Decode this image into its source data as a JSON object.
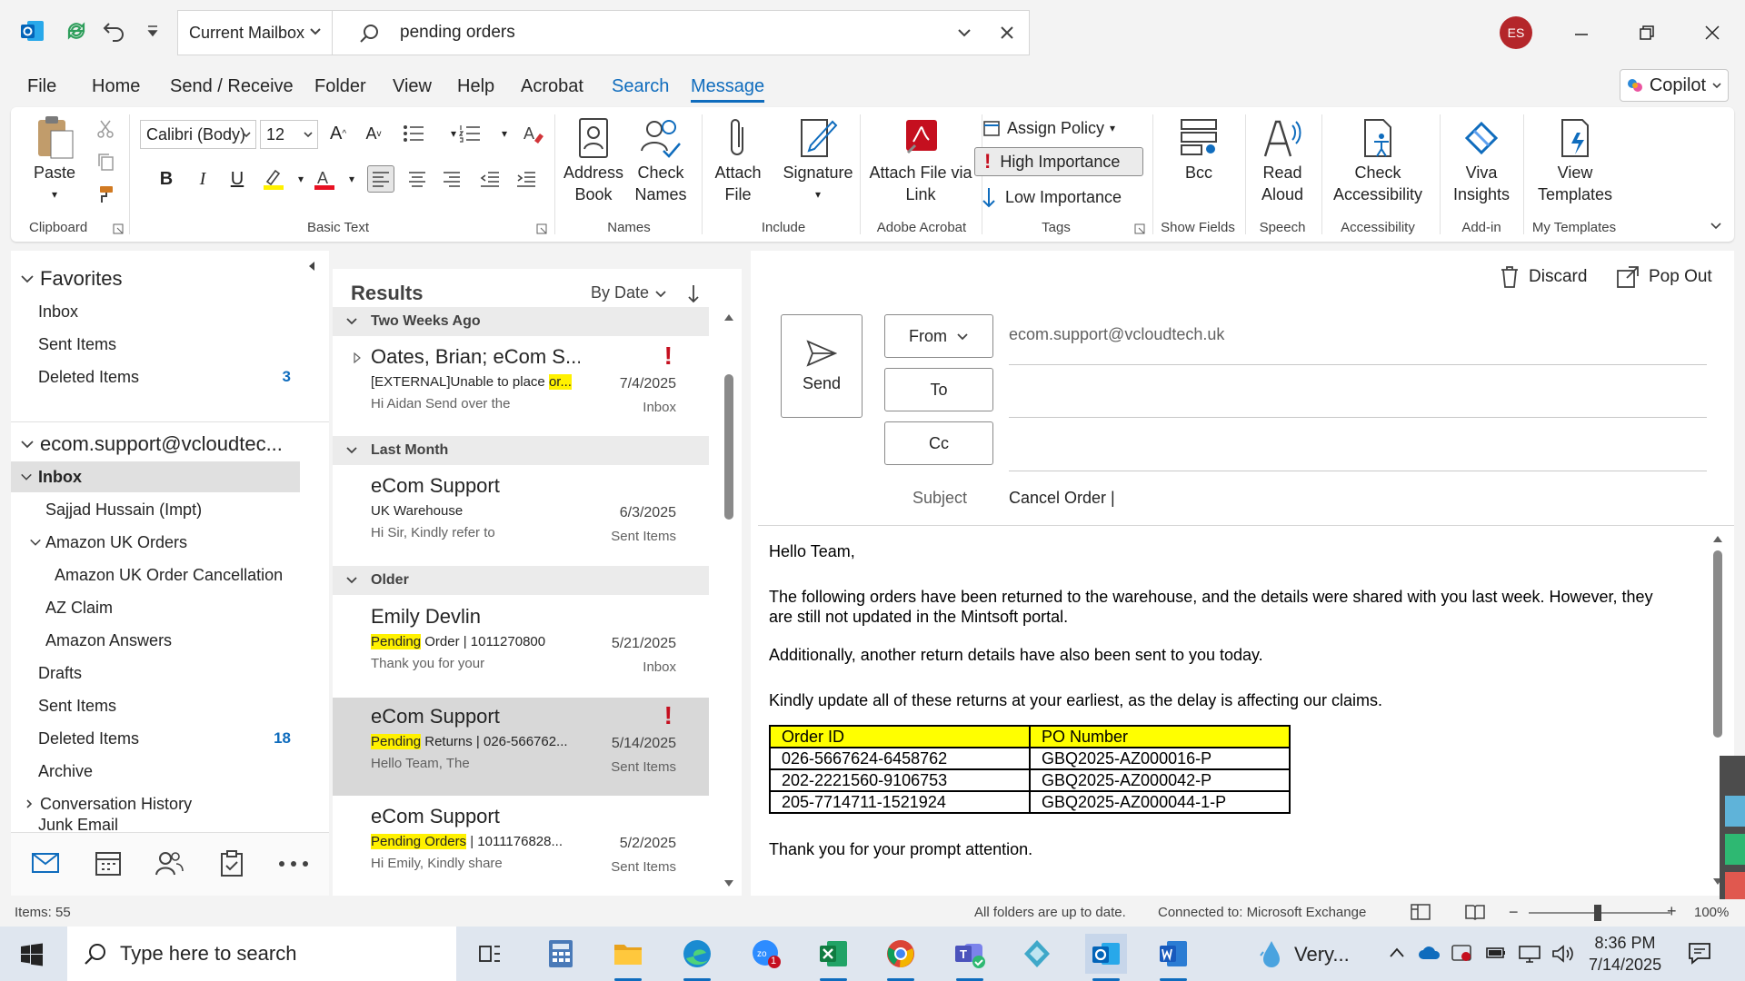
{
  "titlebar": {
    "scope_label": "Current Mailbox",
    "search_value": "pending orders",
    "avatar_initials": "ES"
  },
  "menu": {
    "tabs": [
      "File",
      "Home",
      "Send / Receive",
      "Folder",
      "View",
      "Help",
      "Acrobat",
      "Search",
      "Message"
    ],
    "active_tab": "Message",
    "copilot_label": "Copilot"
  },
  "ribbon": {
    "paste_label": "Paste",
    "font_name": "Calibri (Body)",
    "font_size": "12",
    "address_book_label": "Address Book",
    "check_names_label": "Check Names",
    "attach_file_label": "Attach File",
    "signature_label": "Signature",
    "attach_via_link_label": "Attach File via Link",
    "assign_policy_label": "Assign Policy",
    "high_importance_label": "High Importance",
    "low_importance_label": "Low Importance",
    "bcc_label": "Bcc",
    "read_aloud_label": "Read Aloud",
    "check_accessibility_label": "Check Accessibility",
    "viva_insights_label": "Viva Insights",
    "view_templates_label": "View Templates",
    "groups": {
      "clipboard": "Clipboard",
      "basic_text": "Basic Text",
      "names": "Names",
      "include": "Include",
      "adobe_acrobat": "Adobe Acrobat",
      "tags": "Tags",
      "show_fields": "Show Fields",
      "speech": "Speech",
      "accessibility": "Accessibility",
      "add_in": "Add-in",
      "my_templates": "My Templates"
    }
  },
  "folders": {
    "favorites_label": "Favorites",
    "favorites": [
      {
        "label": "Inbox",
        "count": ""
      },
      {
        "label": "Sent Items",
        "count": ""
      },
      {
        "label": "Deleted Items",
        "count": "3"
      }
    ],
    "account_label": "ecom.support@vcloudtec...",
    "inbox_label": "Inbox",
    "items": [
      {
        "label": "Sajjad Hussain (Impt)",
        "count": ""
      },
      {
        "label": "Amazon UK Orders",
        "count": ""
      },
      {
        "label": "Amazon UK Order Cancellation",
        "count": ""
      },
      {
        "label": "AZ Claim",
        "count": ""
      },
      {
        "label": "Amazon Answers",
        "count": ""
      },
      {
        "label": "Drafts",
        "count": ""
      },
      {
        "label": "Sent Items",
        "count": ""
      },
      {
        "label": "Deleted Items",
        "count": "18"
      },
      {
        "label": "Archive",
        "count": ""
      },
      {
        "label": "Conversation History",
        "count": ""
      },
      {
        "label": "Junk Email",
        "count": ""
      }
    ]
  },
  "results": {
    "title": "Results",
    "sort_label": "By Date",
    "groups": [
      "Two Weeks Ago",
      "Last Month",
      "Older"
    ],
    "messages": [
      {
        "sender": "Oates, Brian;  eCom S...",
        "subject_pre": "[EXTERNAL]Unable to place ",
        "subject_hl": "or...",
        "subject_post": "",
        "preview": "Hi Aidan  Send over the",
        "date": "7/4/2025",
        "folder": "Inbox"
      },
      {
        "sender": "eCom Support",
        "subject_pre": "UK Warehouse",
        "subject_hl": "",
        "subject_post": "",
        "preview": "Hi Sir,  Kindly refer to",
        "date": "6/3/2025",
        "folder": "Sent Items"
      },
      {
        "sender": "Emily Devlin",
        "subject_pre": "",
        "subject_hl": "Pending",
        "subject_post": " Order | 1011270800",
        "preview": "Thank you for your",
        "date": "5/21/2025",
        "folder": "Inbox"
      },
      {
        "sender": "eCom Support",
        "subject_pre": "",
        "subject_hl": "Pending",
        "subject_post": " Returns | 026-566762...",
        "preview": "Hello Team,  The",
        "date": "5/14/2025",
        "folder": "Sent Items"
      },
      {
        "sender": "eCom Support",
        "subject_pre": "",
        "subject_hl": "Pending Orders",
        "subject_post": " |  1011176828...",
        "preview": "Hi Emily,  Kindly share",
        "date": "5/2/2025",
        "folder": "Sent Items"
      }
    ],
    "importance_mark": "!"
  },
  "compose": {
    "discard_label": "Discard",
    "popout_label": "Pop Out",
    "send_label": "Send",
    "from_label": "From",
    "from_value": "ecom.support@vcloudtech.uk",
    "to_label": "To",
    "cc_label": "Cc",
    "subject_label": "Subject",
    "subject_value": "Cancel Order |",
    "body": {
      "greeting": "Hello Team,",
      "para1": "The following orders have been returned to the warehouse, and the details were shared with you last week. However, they are still not updated in the Mintsoft portal.",
      "para2": "Additionally, another return details have also been sent to you today.",
      "para3": "Kindly update all of these returns at your earliest, as the delay is affecting our claims.",
      "table_headers": [
        "Order ID",
        "PO Number"
      ],
      "table_rows": [
        [
          "026-5667624-6458762",
          "GBQ2025-AZ000016-P"
        ],
        [
          "202-2221560-9106753",
          "GBQ2025-AZ000042-P"
        ],
        [
          "205-7714711-1521924",
          "GBQ2025-AZ000044-1-P"
        ]
      ],
      "closing": "Thank you for your prompt attention."
    }
  },
  "status": {
    "items": "Items: 55",
    "sync": "All folders are up to date.",
    "connection": "Connected to: Microsoft Exchange",
    "zoom": "100%"
  },
  "taskbar": {
    "search_placeholder": "Type here to search",
    "weather": "Very...",
    "time": "8:36 PM",
    "date": "7/14/2025",
    "teams_badge": "1"
  },
  "colors": {
    "accent": "#0f6cbd",
    "importance": "#c50f1f",
    "highlight": "#fff100",
    "table_header": "#ffff00"
  }
}
